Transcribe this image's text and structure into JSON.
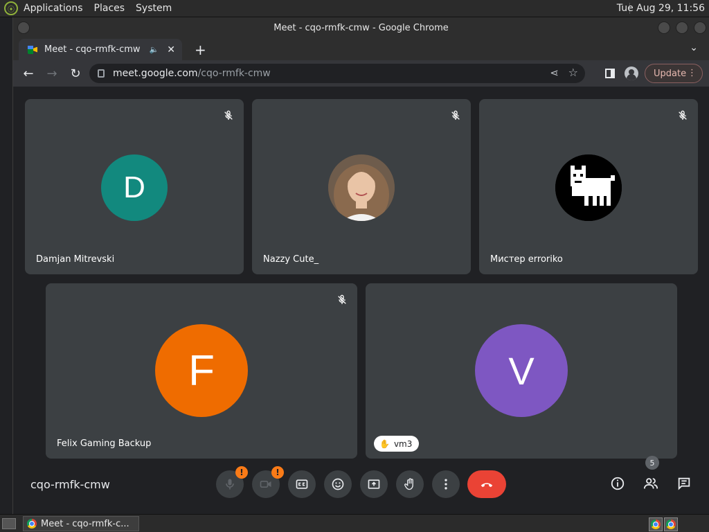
{
  "top_panel": {
    "menus": [
      "Applications",
      "Places",
      "System"
    ],
    "clock": "Tue Aug 29, 11:56"
  },
  "window": {
    "title": "Meet - cqo-rmfk-cmw - Google Chrome"
  },
  "tab": {
    "title": "Meet - cqo-rmfk-cmw",
    "audio_glyph": "🔈",
    "close_glyph": "✕"
  },
  "toolbar": {
    "url_domain": "meet.google.com",
    "url_path": "/cqo-rmfk-cmw",
    "update_label": "Update"
  },
  "participants": [
    {
      "name": "Damjan Mitrevski",
      "initial": "D",
      "color": "#12897e",
      "muted": true
    },
    {
      "name": "Nazzy Cute_",
      "initial": "",
      "color": "#6b5a4a",
      "muted": true
    },
    {
      "name": "Мистер erroriko",
      "initial": "",
      "color": "#000000",
      "muted": true
    },
    {
      "name": "Felix Gaming Backup",
      "initial": "F",
      "color": "#ef6c00",
      "muted": true
    },
    {
      "name": "vm3",
      "initial": "V",
      "color": "#7e57c2",
      "muted": false,
      "hand_raised": true
    }
  ],
  "meeting": {
    "code": "cqo-rmfk-cmw",
    "warning_glyph": "!",
    "people_count": "5"
  },
  "taskbar": {
    "task_label": "Meet - cqo-rmfk-c..."
  },
  "colors": {
    "tile_bg": "#3c4043",
    "leave_red": "#ea4335",
    "warn_orange": "#fa7b17"
  }
}
